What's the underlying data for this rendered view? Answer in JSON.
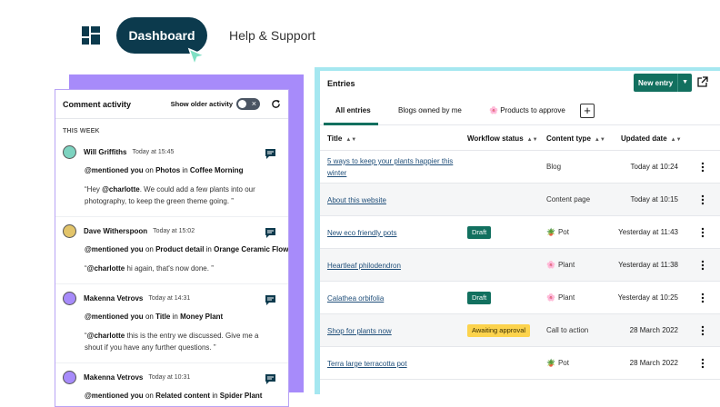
{
  "nav": {
    "dashboard_label": "Dashboard",
    "help_label": "Help & Support"
  },
  "comments": {
    "title": "Comment activity",
    "toggle_label": "Show older activity",
    "toggle_state": "×",
    "section": "THIS WEEK",
    "items": [
      {
        "name": "Will Griffiths",
        "time": "Today at 15:45",
        "mention": "@mentioned you",
        "on": "on",
        "target": "Photos",
        "in": "in",
        "context": "Coffee Morning",
        "quote_open": "“Hey ",
        "quote_handle": "@charlotte",
        "quote_rest": ". We could add a few plants into our photography, to keep the green theme going. ”",
        "avatar_color": "#7dd3c0"
      },
      {
        "name": "Dave Witherspoon",
        "time": "Today at 15:02",
        "mention": "@mentioned you",
        "on": "on",
        "target": "Product detail",
        "in": "in",
        "context": "Orange Ceramic Flower P",
        "quote_open": "“",
        "quote_handle": "@charlotte",
        "quote_rest": " hi again, that's now done. ”",
        "avatar_color": "#e2c46a"
      },
      {
        "name": "Makenna Vetrovs",
        "time": "Today at 14:31",
        "mention": "@mentioned you",
        "on": "on",
        "target": "Title",
        "in": "in",
        "context": "Money Plant",
        "quote_open": "“",
        "quote_handle": "@charlotte",
        "quote_rest": " this is the entry we discussed. Give me a shout if you have any further questions. ”",
        "avatar_color": "#a78bfa"
      },
      {
        "name": "Makenna Vetrovs",
        "time": "Today at 10:31",
        "mention": "@mentioned you",
        "on": "on",
        "target": "Related content",
        "in": "in",
        "context": "Spider Plant",
        "quote_open": "",
        "quote_handle": "",
        "quote_rest": "",
        "avatar_color": "#a78bfa"
      }
    ]
  },
  "entries": {
    "title": "Entries",
    "new_entry_label": "New entry",
    "new_entry_caret": "▼",
    "tabs": [
      {
        "label": "All entries"
      },
      {
        "label": "Blogs owned by me"
      },
      {
        "label": "Products to approve",
        "icon": "🌸"
      }
    ],
    "add_tab": "+",
    "columns": [
      "Title",
      "Workflow status",
      "Content type",
      "Updated date"
    ],
    "sort_glyph": "▲▼",
    "rows": [
      {
        "title": "5 ways to keep your plants happier this winter",
        "status": "",
        "status_kind": "",
        "type": "Blog",
        "type_icon": "",
        "date": "Today at 10:24"
      },
      {
        "title": "About this website",
        "status": "",
        "status_kind": "",
        "type": "Content page",
        "type_icon": "",
        "date": "Today at 10:15"
      },
      {
        "title": "New eco friendly pots",
        "status": "Draft",
        "status_kind": "draft",
        "type": "Pot",
        "type_icon": "🪴",
        "date": "Yesterday at 11:43"
      },
      {
        "title": "Heartleaf philodendron",
        "status": "",
        "status_kind": "",
        "type": "Plant",
        "type_icon": "🌸",
        "date": "Yesterday at 11:38"
      },
      {
        "title": "Calathea orbifolia",
        "status": "Draft",
        "status_kind": "draft",
        "type": "Plant",
        "type_icon": "🌸",
        "date": "Yesterday at 10:25"
      },
      {
        "title": "Shop for plants now",
        "status": "Awaiting approval",
        "status_kind": "awaiting",
        "type": "Call to action",
        "type_icon": "",
        "date": "28 March 2022"
      },
      {
        "title": "Terra large terracotta pot",
        "status": "",
        "status_kind": "",
        "type": "Pot",
        "type_icon": "🪴",
        "date": "28 March 2022"
      }
    ]
  },
  "colors": {
    "brand_dark": "#0c3a4d",
    "accent_green": "#12705f",
    "purple": "#a78bfa",
    "cyan": "#a5e7f0",
    "awaiting": "#fcd34d"
  }
}
